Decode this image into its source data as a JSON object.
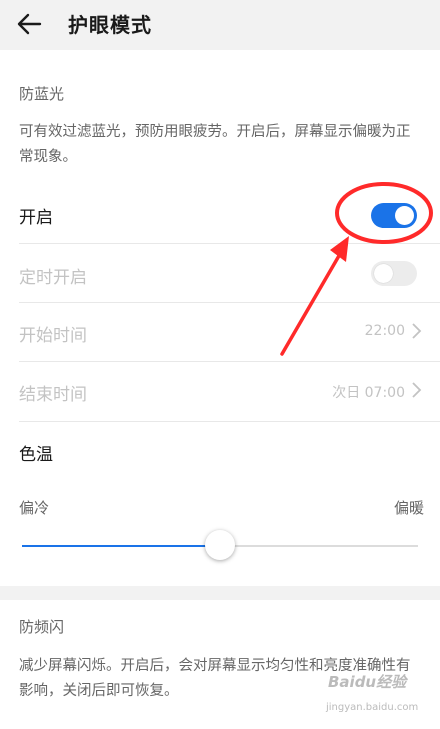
{
  "header": {
    "title": "护眼模式",
    "back_icon": "arrow-left-icon"
  },
  "blue_light": {
    "section_label": "防蓝光",
    "description": "可有效过滤蓝光，预防用眼疲劳。开启后，屏幕显示偏暖为正常现象。"
  },
  "rows": {
    "enable": {
      "label": "开启",
      "on": true
    },
    "schedule": {
      "label": "定时开启",
      "on": false
    },
    "start_time": {
      "label": "开始时间",
      "value": "22:00"
    },
    "end_time": {
      "label": "结束时间",
      "value": "次日 07:00"
    }
  },
  "color_temp": {
    "label": "色温",
    "min_label": "偏冷",
    "max_label": "偏暖",
    "level": 0.5
  },
  "anti_flicker": {
    "section_label": "防频闪",
    "description": "减少屏幕闪烁。开启后，会对屏幕显示均匀性和亮度准确性有影响，关闭后即可恢复。"
  },
  "colors": {
    "accent": "#1a73e8",
    "annotation": "#ff2a2a",
    "section_gap": "#f2f2f2"
  },
  "watermark": {
    "text": "Baidu经验",
    "sub": "jingyan.baidu.com"
  }
}
